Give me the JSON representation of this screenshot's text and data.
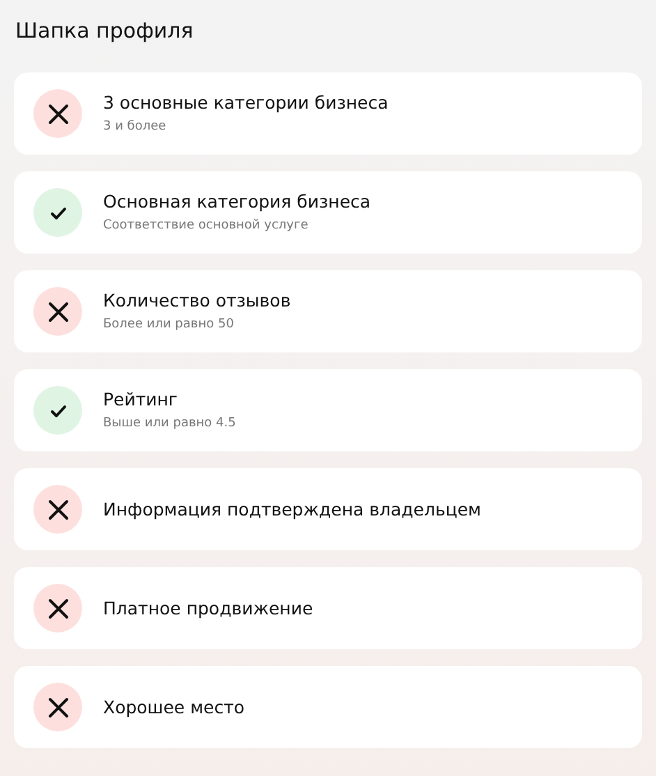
{
  "title": "Шапка профиля",
  "criteria": [
    {
      "passed": false,
      "name": "3 основные категории бизнеса",
      "note": "3 и более"
    },
    {
      "passed": true,
      "name": "Основная категория бизнеса",
      "note": "Соответствие основной услуге"
    },
    {
      "passed": false,
      "name": "Количество отзывов",
      "note": "Более или равно 50"
    },
    {
      "passed": true,
      "name": "Рейтинг",
      "note": "Выше или равно 4.5"
    },
    {
      "passed": false,
      "name": "Информация подтверждена владельцем"
    },
    {
      "passed": false,
      "name": "Платное продвижение"
    },
    {
      "passed": false,
      "name": "Хорошее место"
    }
  ]
}
